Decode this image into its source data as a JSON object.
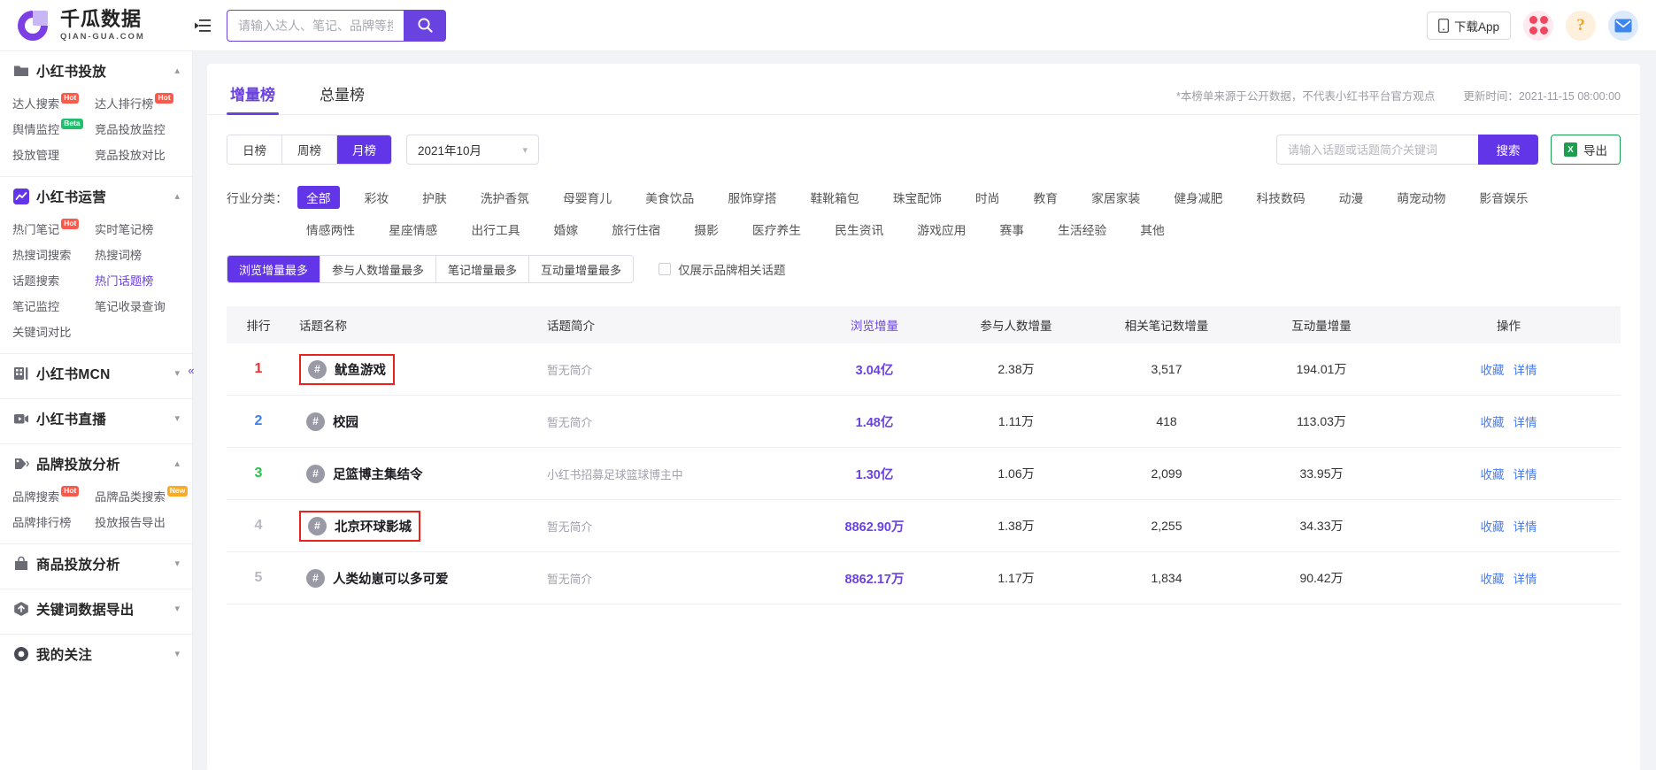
{
  "brand": {
    "cn": "千瓜数据",
    "en": "QIAN-GUA.COM"
  },
  "header": {
    "search_placeholder": "请输入达人、笔记、品牌等搜",
    "search_value": "",
    "search_button": "搜索",
    "download_app": "下载App"
  },
  "sidebar": {
    "groups": [
      {
        "title": "小红书投放",
        "icon": "folder-icon",
        "items": [
          {
            "label": "达人搜索",
            "badge": "Hot",
            "badge_type": "hot",
            "active": false
          },
          {
            "label": "达人排行榜",
            "badge": "Hot",
            "badge_type": "hot",
            "active": false
          },
          {
            "label": "舆情监控",
            "badge": "Beta",
            "badge_type": "beta",
            "active": false
          },
          {
            "label": "竞品投放监控",
            "badge": "",
            "badge_type": "",
            "active": false
          },
          {
            "label": "投放管理",
            "badge": "",
            "badge_type": "",
            "active": false
          },
          {
            "label": "竞品投放对比",
            "badge": "",
            "badge_type": "",
            "active": false
          }
        ]
      },
      {
        "title": "小红书运营",
        "icon": "chart-icon",
        "items": [
          {
            "label": "热门笔记",
            "badge": "Hot",
            "badge_type": "hot",
            "active": false
          },
          {
            "label": "实时笔记榜",
            "badge": "",
            "badge_type": "",
            "active": false
          },
          {
            "label": "热搜词搜索",
            "badge": "",
            "badge_type": "",
            "active": false
          },
          {
            "label": "热搜词榜",
            "badge": "",
            "badge_type": "",
            "active": false
          },
          {
            "label": "话题搜索",
            "badge": "",
            "badge_type": "",
            "active": false
          },
          {
            "label": "热门话题榜",
            "badge": "",
            "badge_type": "",
            "active": true
          },
          {
            "label": "笔记监控",
            "badge": "",
            "badge_type": "",
            "active": false
          },
          {
            "label": "笔记收录查询",
            "badge": "",
            "badge_type": "",
            "active": false
          },
          {
            "label": "关键词对比",
            "badge": "",
            "badge_type": "",
            "active": false
          }
        ]
      },
      {
        "title": "小红书MCN",
        "icon": "grid-icon",
        "items": []
      },
      {
        "title": "小红书直播",
        "icon": "video-icon",
        "items": []
      },
      {
        "title": "品牌投放分析",
        "icon": "tag-icon",
        "items": [
          {
            "label": "品牌搜索",
            "badge": "Hot",
            "badge_type": "hot",
            "active": false
          },
          {
            "label": "品牌品类搜索",
            "badge": "New",
            "badge_type": "new",
            "active": false
          },
          {
            "label": "品牌排行榜",
            "badge": "",
            "badge_type": "",
            "active": false
          },
          {
            "label": "投放报告导出",
            "badge": "",
            "badge_type": "",
            "active": false
          }
        ]
      },
      {
        "title": "商品投放分析",
        "icon": "bag-icon",
        "items": []
      },
      {
        "title": "关键词数据导出",
        "icon": "upload-icon",
        "items": []
      },
      {
        "title": "我的关注",
        "icon": "eye-icon",
        "items": []
      }
    ]
  },
  "main": {
    "tabs": [
      {
        "label": "增量榜",
        "active": true
      },
      {
        "label": "总量榜",
        "active": false
      }
    ],
    "note_source": "*本榜单来源于公开数据，不代表小红书平台官方观点",
    "note_update": "更新时间：2021-11-15 08:00:00",
    "period_segments": [
      {
        "label": "日榜",
        "active": false
      },
      {
        "label": "周榜",
        "active": false
      },
      {
        "label": "月榜",
        "active": true
      }
    ],
    "date_value": "2021年10月",
    "keyword_placeholder": "请输入话题或话题简介关键词",
    "keyword_value": "",
    "keyword_search_label": "搜索",
    "export_label": "导出",
    "category_label": "行业分类：",
    "categories": [
      {
        "label": "全部",
        "active": true
      },
      {
        "label": "彩妆",
        "active": false
      },
      {
        "label": "护肤",
        "active": false
      },
      {
        "label": "洗护香氛",
        "active": false
      },
      {
        "label": "母婴育儿",
        "active": false
      },
      {
        "label": "美食饮品",
        "active": false
      },
      {
        "label": "服饰穿搭",
        "active": false
      },
      {
        "label": "鞋靴箱包",
        "active": false
      },
      {
        "label": "珠宝配饰",
        "active": false
      },
      {
        "label": "时尚",
        "active": false
      },
      {
        "label": "教育",
        "active": false
      },
      {
        "label": "家居家装",
        "active": false
      },
      {
        "label": "健身减肥",
        "active": false
      },
      {
        "label": "科技数码",
        "active": false
      },
      {
        "label": "动漫",
        "active": false
      },
      {
        "label": "萌宠动物",
        "active": false
      },
      {
        "label": "影音娱乐",
        "active": false
      },
      {
        "label": "情感两性",
        "active": false
      },
      {
        "label": "星座情感",
        "active": false
      },
      {
        "label": "出行工具",
        "active": false
      },
      {
        "label": "婚嫁",
        "active": false
      },
      {
        "label": "旅行住宿",
        "active": false
      },
      {
        "label": "摄影",
        "active": false
      },
      {
        "label": "医疗养生",
        "active": false
      },
      {
        "label": "民生资讯",
        "active": false
      },
      {
        "label": "游戏应用",
        "active": false
      },
      {
        "label": "赛事",
        "active": false
      },
      {
        "label": "生活经验",
        "active": false
      },
      {
        "label": "其他",
        "active": false
      }
    ],
    "sort_segments": [
      {
        "label": "浏览增量最多",
        "active": true
      },
      {
        "label": "参与人数增量最多",
        "active": false
      },
      {
        "label": "笔记增量最多",
        "active": false
      },
      {
        "label": "互动量增量最多",
        "active": false
      }
    ],
    "brand_only_label": "仅展示品牌相关话题",
    "brand_only_checked": false
  },
  "table": {
    "headers": {
      "rank": "排行",
      "name": "话题名称",
      "desc": "话题简介",
      "view": "浏览增量",
      "participants": "参与人数增量",
      "notes": "相关笔记数增量",
      "interactions": "互动量增量",
      "actions": "操作"
    },
    "action_fav": "收藏",
    "action_detail": "详情",
    "rows": [
      {
        "rank": "1",
        "name": "鱿鱼游戏",
        "desc": "暂无简介",
        "view": "3.04亿",
        "participants": "2.38万",
        "notes": "3,517",
        "interactions": "194.01万",
        "highlighted": true
      },
      {
        "rank": "2",
        "name": "校园",
        "desc": "暂无简介",
        "view": "1.48亿",
        "participants": "1.11万",
        "notes": "418",
        "interactions": "113.03万",
        "highlighted": false
      },
      {
        "rank": "3",
        "name": "足篮博主集结令",
        "desc": "小红书招募足球篮球博主中",
        "view": "1.30亿",
        "participants": "1.06万",
        "notes": "2,099",
        "interactions": "33.95万",
        "highlighted": false
      },
      {
        "rank": "4",
        "name": "北京环球影城",
        "desc": "暂无简介",
        "view": "8862.90万",
        "participants": "1.38万",
        "notes": "2,255",
        "interactions": "34.33万",
        "highlighted": true
      },
      {
        "rank": "5",
        "name": "人类幼崽可以多可爱",
        "desc": "暂无简介",
        "view": "8862.17万",
        "participants": "1.17万",
        "notes": "1,834",
        "interactions": "90.42万",
        "highlighted": false
      }
    ]
  },
  "colors": {
    "brand_purple": "#6235e8",
    "accent_purple": "#6a42e0",
    "highlight_red": "#e8231c",
    "link_blue": "#4a7ef5"
  }
}
